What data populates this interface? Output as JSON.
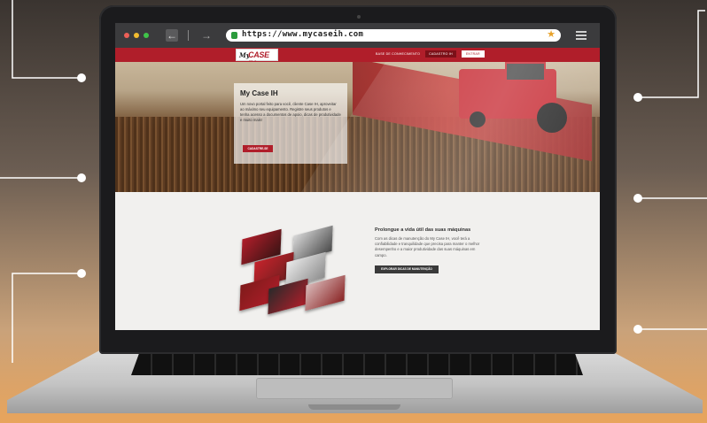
{
  "browser": {
    "url": "https://www.mycaseih.com"
  },
  "site": {
    "logo_my": "My",
    "logo_case": "CASE IH",
    "nav": {
      "link1": "BASE DE CONHECIMENTO",
      "link2": "CADASTRO IH",
      "link3": "ENTRAR"
    }
  },
  "hero": {
    "title": "My Case IH",
    "text": "Um novo portal feito para você, cliente Case IH, aproveitar ao máximo seu equipamento. Registre seus produtos e tenha acesso a documentos de apoio, dicas de produtividade e muito mais!",
    "button": "CADASTRE-SE"
  },
  "maintenance": {
    "title": "Prolongue a vida útil das suas máquinas",
    "text": "Com as dicas de manutenção do My Case IH, você terá a confiabilidade e tranquilidade que precisa para manter o melhor desempenho e a maior produtividade das suas máquinas em campo.",
    "button": "EXPLORAR DICAS DE MANUTENÇÃO"
  },
  "icons": {
    "back": "arrow-left-icon",
    "forward": "arrow-right-icon",
    "lock": "lock-icon",
    "star": "star-icon",
    "menu": "hamburger-icon"
  },
  "colors": {
    "brand_red": "#b01e2a",
    "toolbar": "#3b3b3d"
  }
}
